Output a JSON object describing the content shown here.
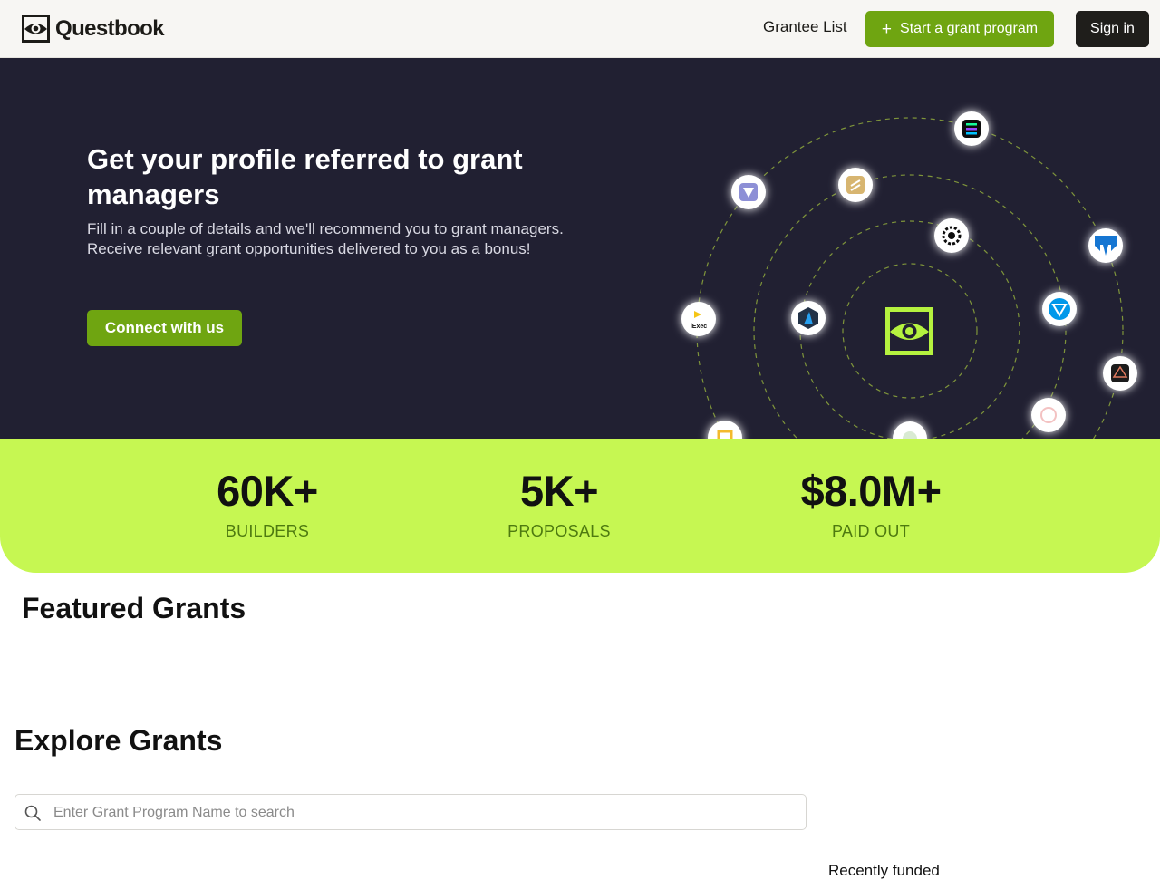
{
  "header": {
    "brand": "Questbook",
    "nav_link": "Grantee List",
    "start_label": "Start a grant program",
    "signin_label": "Sign in"
  },
  "hero": {
    "title": "Get your profile referred to grant managers",
    "description": "Fill in a couple of details and we'll recommend you to grant managers. Receive relevant grant opportunities delivered to you as a bonus!",
    "cta_label": "Connect with us",
    "orbit_icons": [
      "solana-icon",
      "polygon-icon",
      "jar-icon",
      "iexec-icon",
      "arbitrum-icon",
      "ton-icon",
      "compass-icon",
      "binance-icon",
      "bell-icon",
      "ai-icon",
      "ens-icon",
      "prism-icon",
      "gear-icon"
    ],
    "iexec_text": "iExec"
  },
  "stats": [
    {
      "value": "60K+",
      "label": "BUILDERS"
    },
    {
      "value": "5K+",
      "label": "PROPOSALS"
    },
    {
      "value": "$8.0M+",
      "label": "PAID OUT"
    }
  ],
  "featured": {
    "title": "Featured Grants"
  },
  "explore": {
    "title": "Explore Grants",
    "search_placeholder": "Enter Grant Program Name to search",
    "sort_label": "Recently funded"
  },
  "colors": {
    "accent_green": "#6fa511",
    "stats_bg": "#c6f752",
    "hero_bg": "#212032",
    "dark_button": "#1f1e1b"
  }
}
